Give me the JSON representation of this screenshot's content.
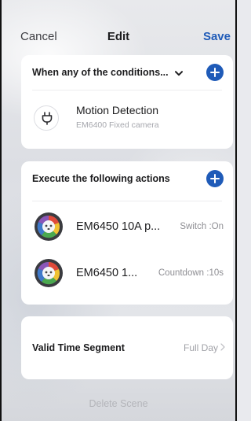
{
  "nav": {
    "cancel_label": "Cancel",
    "title": "Edit",
    "save_label": "Save"
  },
  "conditions": {
    "header_label": "When any of the conditions...",
    "items": [
      {
        "title": "Motion Detection",
        "subtitle": "EM6400 Fixed camera",
        "icon": "plug-icon"
      }
    ]
  },
  "actions": {
    "header_label": "Execute the following actions",
    "items": [
      {
        "name": "EM6450 10A p...",
        "state": "Switch :On",
        "icon": "device-icon"
      },
      {
        "name": "EM6450 1...",
        "state": "Countdown :10s",
        "icon": "device-icon"
      }
    ]
  },
  "time_segment": {
    "label": "Valid Time Segment",
    "value": "Full Day"
  },
  "delete_label": "Delete Scene",
  "colors": {
    "accent": "#1f5bb8",
    "card": "#ffffff",
    "muted_text": "#a6a7ad"
  }
}
